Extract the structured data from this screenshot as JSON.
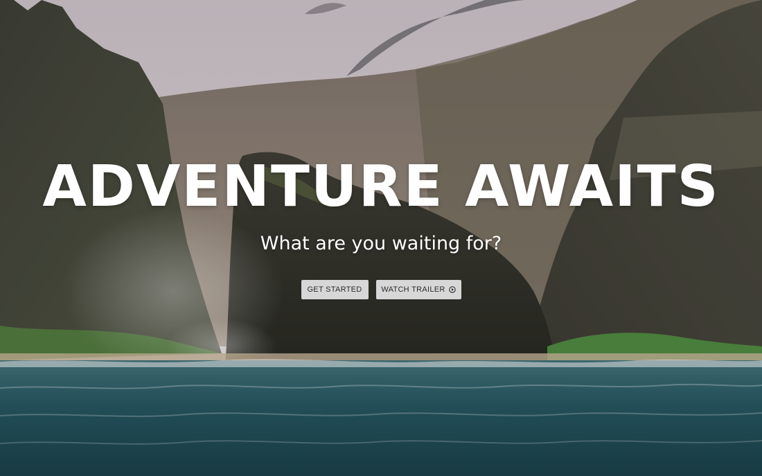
{
  "hero": {
    "headline": "ADVENTURE AWAITS",
    "subheadline": "What are you waiting for?",
    "buttons": {
      "get_started_label": "GET STARTED",
      "watch_trailer_label": "WATCH TRAILER",
      "watch_trailer_icon": "play-circle-icon"
    }
  },
  "colors": {
    "text": "#ffffff",
    "button_bg": "#d7d7d7",
    "button_text": "#2a2a2a",
    "sky": "#d9d2d6",
    "ocean": "#1f4f5a"
  }
}
